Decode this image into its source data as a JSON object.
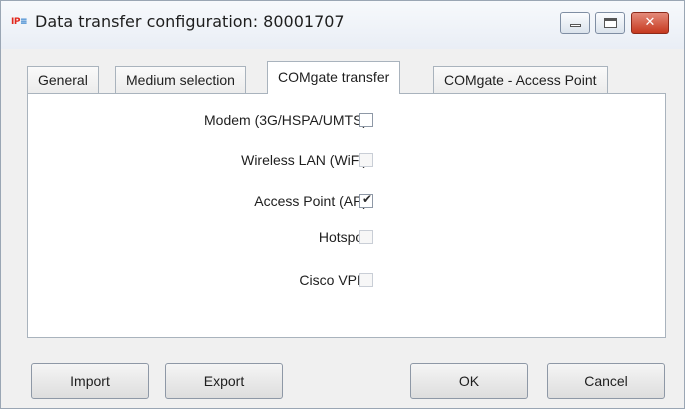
{
  "window": {
    "title": "Data transfer configuration: 80001707",
    "app_icon": "IP≡"
  },
  "titlebar_buttons": {
    "minimize_icon": "minimize-icon",
    "maximize_icon": "maximize-icon",
    "close_label": "✕"
  },
  "tabs": [
    {
      "label": "General",
      "active": false
    },
    {
      "label": "Medium selection",
      "active": false
    },
    {
      "label": "COMgate transfer",
      "active": true
    },
    {
      "label": "COMgate - Access Point",
      "active": false
    }
  ],
  "options": [
    {
      "label": "Modem (3G/HSPA/UMTS):",
      "checked": false,
      "enabled": true
    },
    {
      "label": "Wireless LAN (WiFi):",
      "checked": false,
      "enabled": false
    },
    {
      "label": "Access Point (AP):",
      "checked": true,
      "enabled": true
    },
    {
      "label": "Hotspot:",
      "checked": false,
      "enabled": false
    },
    {
      "label": "Cisco VPN:",
      "checked": false,
      "enabled": false
    }
  ],
  "buttons": {
    "import_label": "Import",
    "export_label": "Export",
    "ok_label": "OK",
    "cancel_label": "Cancel"
  },
  "colors": {
    "close_button": "#c6391f",
    "app_icon_red": "#e2261b",
    "app_icon_blue": "#1e74c8"
  }
}
